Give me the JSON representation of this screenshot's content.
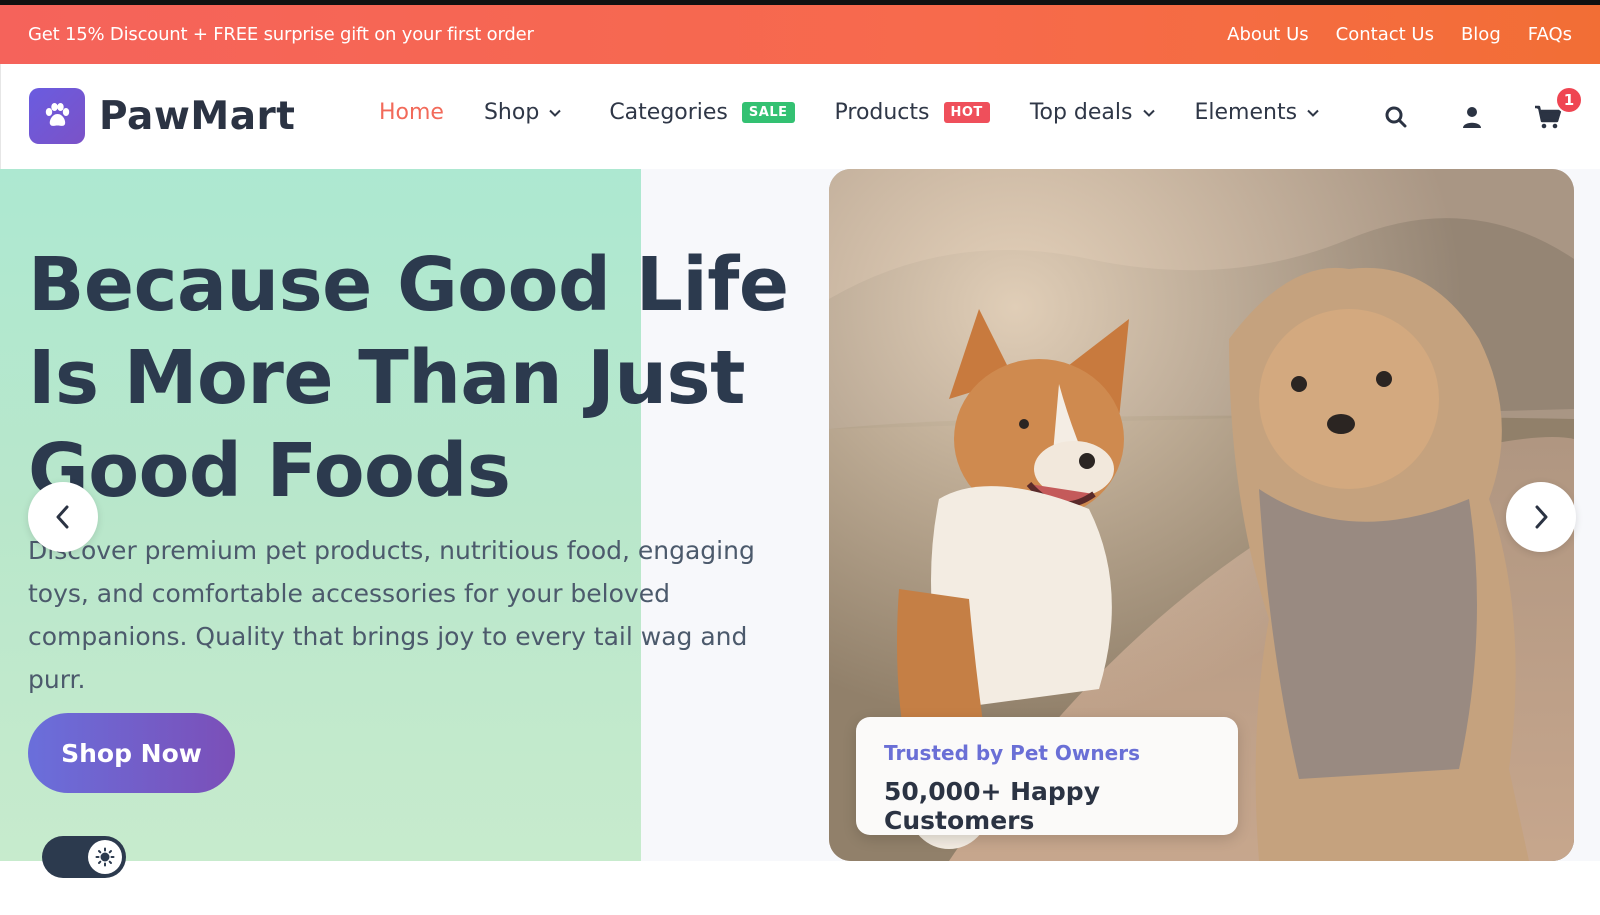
{
  "announcement": {
    "promo": "Get 15% Discount + FREE surprise gift on your first order",
    "links": [
      "About Us",
      "Contact Us",
      "Blog",
      "FAQs"
    ]
  },
  "header": {
    "brand": "PawMart",
    "nav": {
      "home": "Home",
      "shop": "Shop",
      "categories": "Categories",
      "categories_badge": "SALE",
      "products": "Products",
      "products_badge": "HOT",
      "top_deals": "Top deals",
      "elements": "Elements"
    },
    "cart_count": "1",
    "icons": [
      "search-icon",
      "user-icon",
      "cart-icon"
    ]
  },
  "hero": {
    "headline": "Because Good Life Is More Than Just Good Foods",
    "description": "Discover premium pet products, nutritious food, engaging toys, and comfortable accessories for your beloved companions. Quality that brings joy to every tail wag and purr.",
    "cta": "Shop Now",
    "trust_label": "Trusted by Pet Owners",
    "trust_value": "50,000+ Happy Customers"
  },
  "colors": {
    "announcement_bar": "#f5635b",
    "accent": "#f26a5a",
    "sale_badge": "#33c172",
    "hot_badge": "#ef4f5b",
    "brand_purple": "#6a5ce0",
    "heading": "#2c3a4e"
  }
}
